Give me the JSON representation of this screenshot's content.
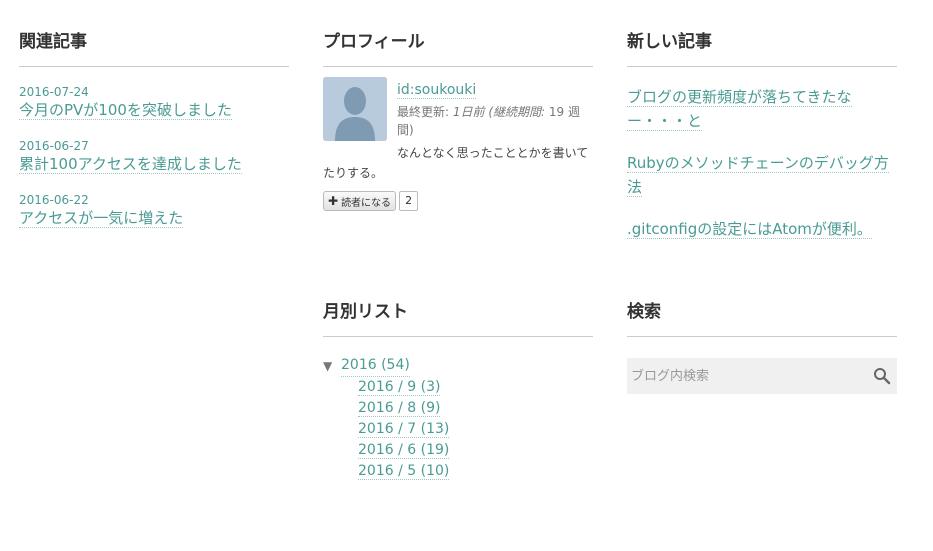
{
  "related": {
    "title": "関連記事",
    "items": [
      {
        "date": "2016-07-24",
        "title": "今月のPVが100を突破しました"
      },
      {
        "date": "2016-06-27",
        "title": "累計100アクセスを達成しました"
      },
      {
        "date": "2016-06-22",
        "title": "アクセスが一気に増えた"
      }
    ]
  },
  "profile": {
    "title": "プロフィール",
    "id": "id:soukouki",
    "meta_label_updated": "最終更新:",
    "meta_updated": "1日前",
    "meta_label_period": "(継続期間:",
    "meta_period": "19 週間)",
    "description": "なんとなく思ったこととかを書いてたりする。",
    "subscribe_label": "読者になる",
    "subscribe_count": "2"
  },
  "recent": {
    "title": "新しい記事",
    "items": [
      "ブログの更新頻度が落ちてきたなー・・・と",
      "Rubyのメソッドチェーンのデバッグ方法",
      ".gitconfigの設定にはAtomが便利。"
    ]
  },
  "archive": {
    "title": "月別リスト",
    "year": "2016 (54)",
    "months": [
      "2016 / 9 (3)",
      "2016 / 8 (9)",
      "2016 / 7 (13)",
      "2016 / 6 (19)",
      "2016 / 5 (10)"
    ]
  },
  "search": {
    "title": "検索",
    "placeholder": "ブログ内検索"
  },
  "icons": {
    "search": "search-icon",
    "avatar": "default-avatar-icon",
    "plus": "plus-icon",
    "triangle": "triangle-down-icon"
  },
  "colors": {
    "link": "#4a9b94",
    "border": "#cccccc",
    "search_bg": "#f0f0f0"
  }
}
